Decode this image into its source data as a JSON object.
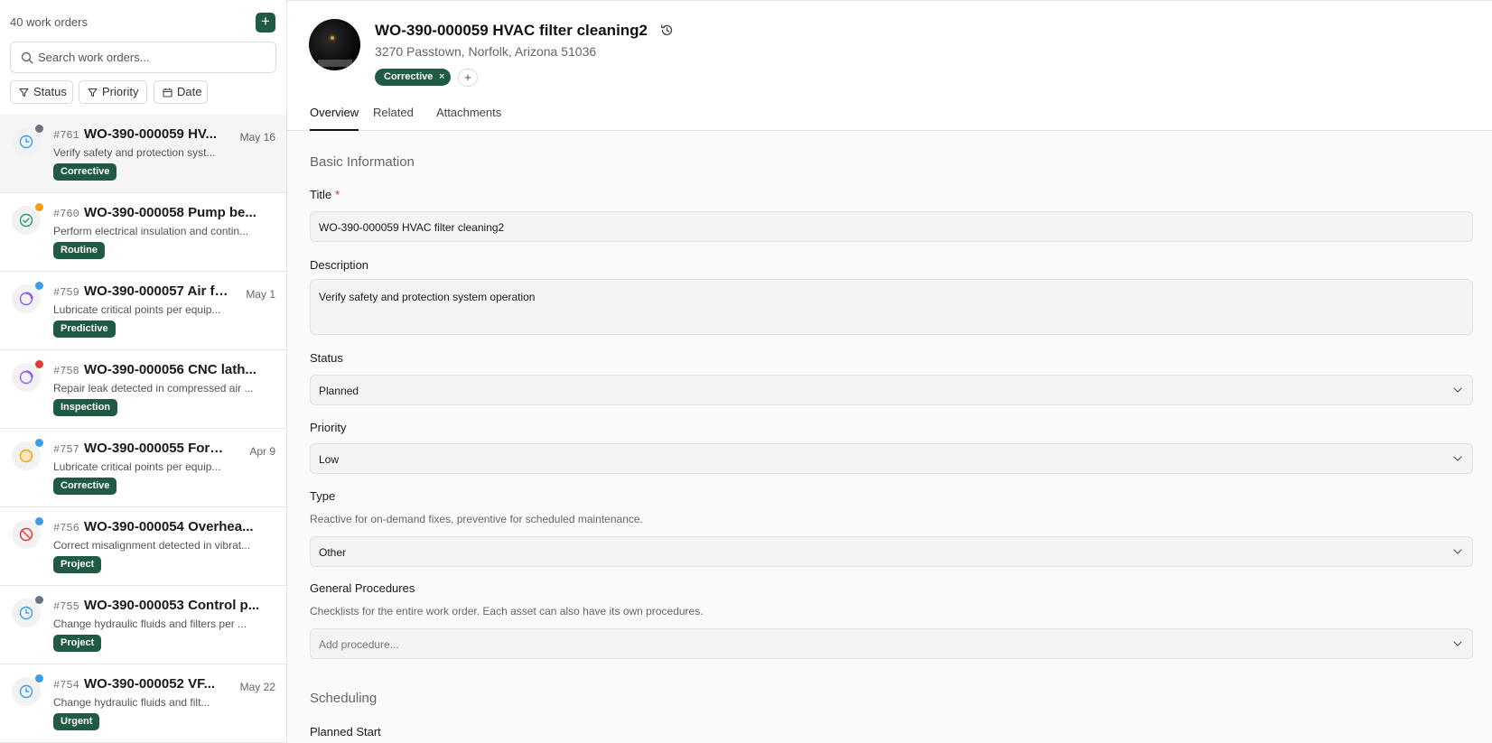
{
  "sidebar": {
    "count_label": "40 work orders",
    "add_label": "+",
    "search_placeholder": "Search work orders...",
    "filters": [
      {
        "label": "Status"
      },
      {
        "label": "Priority"
      },
      {
        "label": "Date"
      }
    ],
    "items": [
      {
        "num": "#761",
        "title": "WO-390-000059 HV...",
        "date": "May 16",
        "desc": "Verify safety and protection syst...",
        "badge": "Corrective",
        "status_icon": "clock-icon",
        "dot_color": "#6b7280"
      },
      {
        "num": "#760",
        "title": "WO-390-000058 Pump be...",
        "date": "",
        "desc": "Perform electrical insulation and contin...",
        "badge": "Routine",
        "status_icon": "check-circle-icon",
        "dot_color": "#f59e0b"
      },
      {
        "num": "#759",
        "title": "WO-390-000057 Air fi...",
        "date": "May 1",
        "desc": "Lubricate critical points per equip...",
        "badge": "Predictive",
        "status_icon": "progress-circle-icon",
        "dot_color": "#3b9ee8"
      },
      {
        "num": "#758",
        "title": "WO-390-000056 CNC lath...",
        "date": "",
        "desc": "Repair leak detected in compressed air ...",
        "badge": "Inspection",
        "status_icon": "progress-circle-icon",
        "dot_color": "#e53935"
      },
      {
        "num": "#757",
        "title": "WO-390-000055 Forkl...",
        "date": "Apr 9",
        "desc": "Lubricate critical points per equip...",
        "badge": "Corrective",
        "status_icon": "pause-circle-icon",
        "dot_color": "#3b9ee8"
      },
      {
        "num": "#756",
        "title": "WO-390-000054 Overhea...",
        "date": "",
        "desc": "Correct misalignment detected in vibrat...",
        "badge": "Project",
        "status_icon": "cancel-icon",
        "dot_color": "#3b9ee8"
      },
      {
        "num": "#755",
        "title": "WO-390-000053 Control p...",
        "date": "",
        "desc": "Change hydraulic fluids and filters per ...",
        "badge": "Project",
        "status_icon": "clock-icon",
        "dot_color": "#6b7280"
      },
      {
        "num": "#754",
        "title": "WO-390-000052 VF...",
        "date": "May 22",
        "desc": "Change hydraulic fluids and filt...",
        "badge": "Urgent",
        "status_icon": "clock-icon",
        "dot_color": "#3b9ee8"
      }
    ]
  },
  "header": {
    "title": "WO-390-000059 HVAC filter cleaning2",
    "address": "3270 Passtown, Norfolk, Arizona 51036",
    "tag": "Corrective",
    "tag_remove": "×",
    "tag_add": "+"
  },
  "tabs": [
    {
      "label": "Overview"
    },
    {
      "label": "Related"
    },
    {
      "label": "Attachments"
    }
  ],
  "form": {
    "section_basic": "Basic Information",
    "title_label": "Title",
    "required_mark": "*",
    "title_value": "WO-390-000059 HVAC filter cleaning2",
    "description_label": "Description",
    "description_value": "Verify safety and protection system operation",
    "status_label": "Status",
    "status_value": "Planned",
    "priority_label": "Priority",
    "priority_value": "Low",
    "type_label": "Type",
    "type_help": "Reactive for on-demand fixes, preventive for scheduled maintenance.",
    "type_value": "Other",
    "procedures_label": "General Procedures",
    "procedures_help": "Checklists for the entire work order. Each asset can also have its own procedures.",
    "procedures_placeholder": "Add procedure...",
    "section_scheduling": "Scheduling",
    "planned_start_label": "Planned Start"
  },
  "colors": {
    "brand_green": "#1f5a42"
  }
}
